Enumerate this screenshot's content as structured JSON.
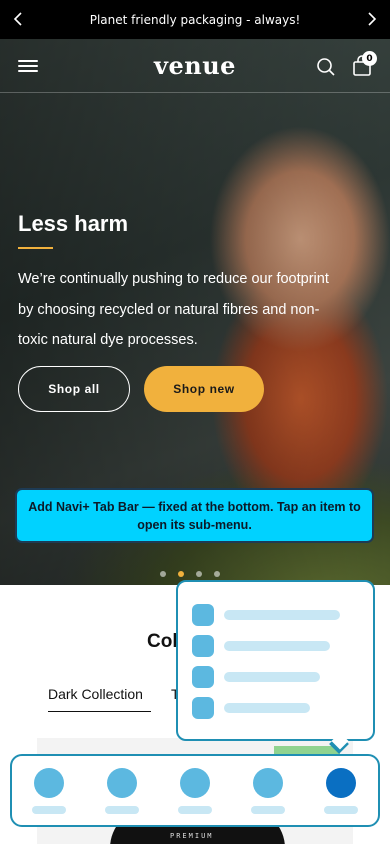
{
  "announcement": {
    "text": "Planet friendly packaging - always!"
  },
  "header": {
    "logo": "venue",
    "cart_count": "0"
  },
  "hero": {
    "title": "Less harm",
    "body": "We’re continually pushing to reduce our footprint by choosing recycled or natural fibres and non-toxic natural dye processes.",
    "primary_button": "Shop all",
    "secondary_button": "Shop new"
  },
  "tooltip": {
    "text": "Add Navi+ Tab Bar — fixed at the bottom. Tap an item to open its sub-menu."
  },
  "collection": {
    "title_fragment": "Col",
    "tabs": [
      "Dark Collection",
      "T"
    ]
  },
  "product": {
    "shirt_text": "PREMIUM"
  },
  "colors": {
    "accent": "#f1b13d",
    "tooltip_bg": "#00d2ff",
    "navi_border": "#1f8fb3",
    "navi_active": "#0a6fc2"
  }
}
